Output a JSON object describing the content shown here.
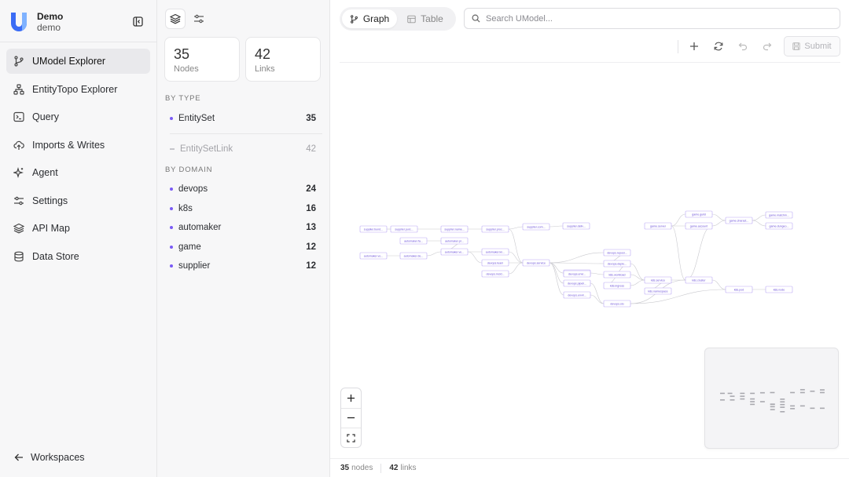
{
  "brand": {
    "title": "Demo",
    "subtitle": "demo"
  },
  "nav": {
    "items": [
      {
        "label": "UModel Explorer",
        "icon": "branch-icon",
        "active": true
      },
      {
        "label": "EntityTopo Explorer",
        "icon": "sitemap-icon",
        "active": false
      },
      {
        "label": "Query",
        "icon": "terminal-icon",
        "active": false
      },
      {
        "label": "Imports & Writes",
        "icon": "cloud-upload-icon",
        "active": false
      },
      {
        "label": "Agent",
        "icon": "sparkles-icon",
        "active": false
      },
      {
        "label": "Settings",
        "icon": "sliders-icon",
        "active": false
      },
      {
        "label": "API Map",
        "icon": "layers-icon",
        "active": false
      },
      {
        "label": "Data Store",
        "icon": "database-icon",
        "active": false
      }
    ],
    "workspaces_label": "Workspaces"
  },
  "panel": {
    "stats": [
      {
        "value": "35",
        "label": "Nodes"
      },
      {
        "value": "42",
        "label": "Links"
      }
    ],
    "by_type_label": "BY TYPE",
    "types": [
      {
        "name": "EntitySet",
        "count": "35"
      },
      {
        "name": "EntitySetLink",
        "count": "42"
      }
    ],
    "by_domain_label": "BY DOMAIN",
    "domains": [
      {
        "name": "devops",
        "count": "24"
      },
      {
        "name": "k8s",
        "count": "16"
      },
      {
        "name": "automaker",
        "count": "13"
      },
      {
        "name": "game",
        "count": "12"
      },
      {
        "name": "supplier",
        "count": "12"
      }
    ]
  },
  "main": {
    "tabs": [
      {
        "label": "Graph"
      },
      {
        "label": "Table"
      }
    ],
    "search_placeholder": "Search UModel...",
    "submit_label": "Submit",
    "footer": {
      "nodes_count": "35",
      "nodes_label": "nodes",
      "links_count": "42",
      "links_label": "links"
    }
  },
  "colors": {
    "accent": "#7a5af5",
    "node_border": "#b9a8f5",
    "logo": "#3b6cf5"
  },
  "graph": {
    "nodes": [
      {
        "label": "supplier.bund..."
      },
      {
        "label": "supplier.purc..."
      },
      {
        "label": "supplier.name..."
      },
      {
        "label": "supplier.proc..."
      },
      {
        "label": "supplier.com..."
      },
      {
        "label": "supplier.deliv..."
      },
      {
        "label": "automaker.fa..."
      },
      {
        "label": "automaker.pr..."
      },
      {
        "label": "automaker.ve..."
      },
      {
        "label": "automaker.kn..."
      },
      {
        "label": "automaker.de..."
      },
      {
        "label": "automaker.vo..."
      },
      {
        "label": "devops.team"
      },
      {
        "label": "devops.incid..."
      },
      {
        "label": "devops.service"
      },
      {
        "label": "devops.cicd..."
      },
      {
        "label": "devops.reposi..."
      },
      {
        "label": "devops.deplo..."
      },
      {
        "label": "devops.pipeli..."
      },
      {
        "label": "devops.envir..."
      },
      {
        "label": "devops.slo"
      },
      {
        "label": "k8s.ingress"
      },
      {
        "label": "k8s.service"
      },
      {
        "label": "k8s.namespace"
      },
      {
        "label": "k8s.cluster"
      },
      {
        "label": "k8s.workload"
      },
      {
        "label": "k8s.pod"
      },
      {
        "label": "k8s.node"
      },
      {
        "label": "game.server"
      },
      {
        "label": "game.guild"
      },
      {
        "label": "game.account"
      },
      {
        "label": "game.charact..."
      },
      {
        "label": "game.matchm..."
      },
      {
        "label": "game.dungeo..."
      },
      {
        "label": "devops.envi..."
      }
    ]
  }
}
